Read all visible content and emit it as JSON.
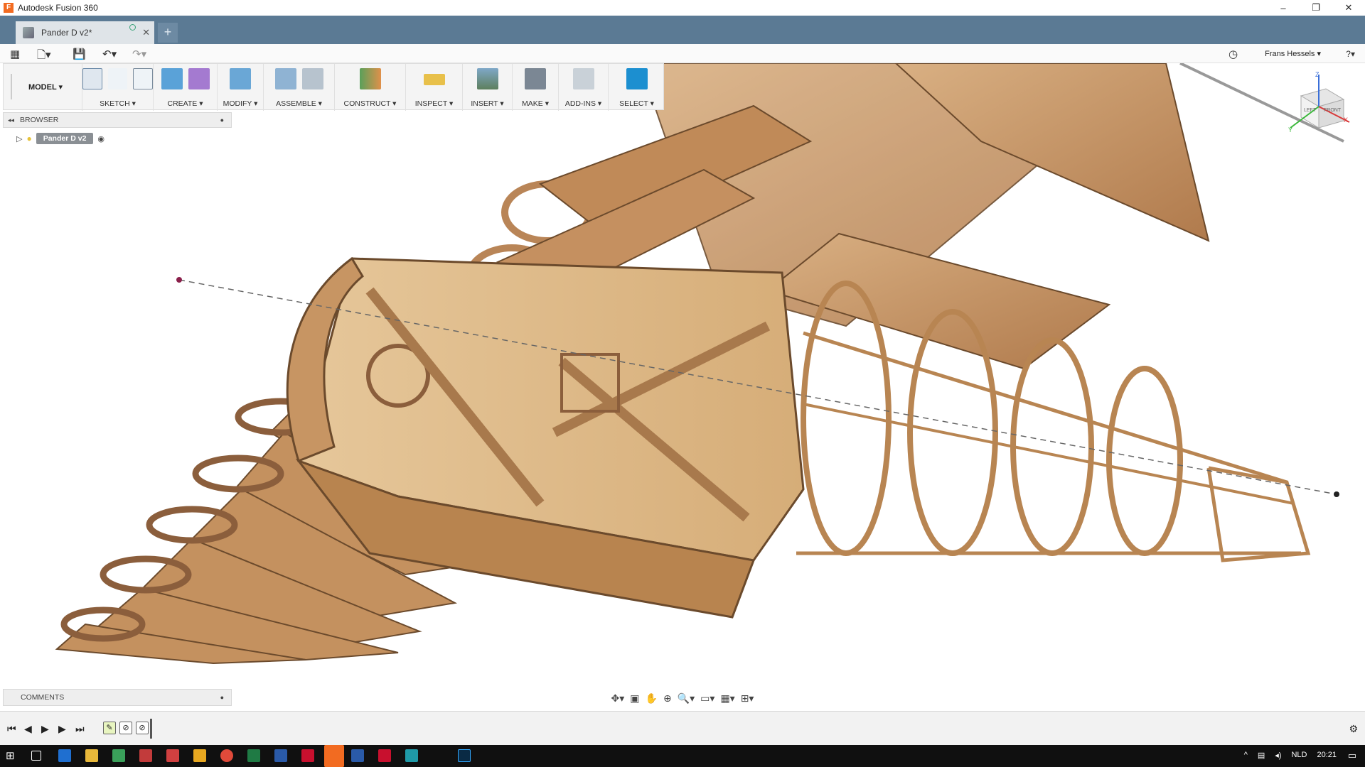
{
  "window": {
    "title": "Autodesk Fusion 360",
    "app_icon_letter": "F",
    "controls": [
      "–",
      "❐",
      "✕"
    ]
  },
  "document_tab": {
    "label": "Pander D v2*",
    "close": "✕",
    "new_tab": "+"
  },
  "quick_access": {
    "user_name": "Frans Hessels ▾",
    "help": "?▾"
  },
  "toolbar": {
    "workspace": "MODEL ▾",
    "groups": [
      {
        "label": "SKETCH ▾"
      },
      {
        "label": "CREATE ▾"
      },
      {
        "label": "MODIFY ▾"
      },
      {
        "label": "ASSEMBLE ▾"
      },
      {
        "label": "CONSTRUCT ▾"
      },
      {
        "label": "INSPECT ▾"
      },
      {
        "label": "INSERT ▾"
      },
      {
        "label": "MAKE ▾"
      },
      {
        "label": "ADD-INS ▾"
      },
      {
        "label": "SELECT ▾"
      }
    ]
  },
  "browser": {
    "header": "BROWSER",
    "root_label": "Pander D v2"
  },
  "comments": {
    "header": "COMMENTS"
  },
  "viewcube": {
    "faces": [
      "LEFT",
      "FRONT"
    ],
    "axes": [
      "Z",
      "X",
      "Y"
    ]
  },
  "taskbar": {
    "language": "NLD",
    "time": "20:21"
  },
  "colors": {
    "tab_bar": "#5b7a94",
    "wood": "#c9996a",
    "wood_dark": "#8b5e3c",
    "select_accent": "#1c8fd0"
  }
}
